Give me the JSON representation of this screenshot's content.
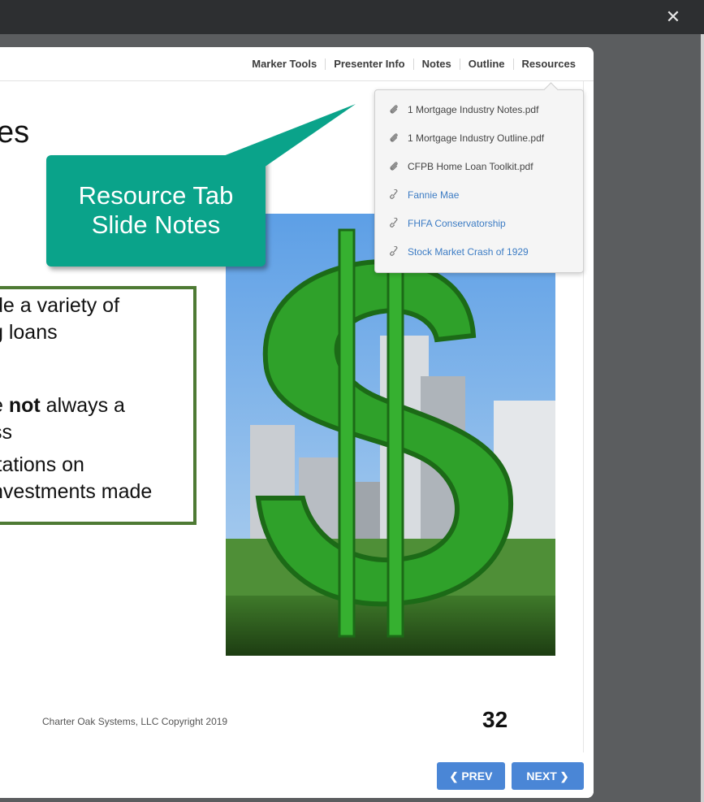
{
  "window": {
    "close_glyph": "✕",
    "close_icon": "close-icon"
  },
  "nav": {
    "tabs": [
      {
        "label": "Marker Tools"
      },
      {
        "label": "Presenter Info"
      },
      {
        "label": "Notes"
      },
      {
        "label": "Outline"
      },
      {
        "label": "Resources"
      }
    ]
  },
  "resources": {
    "items": [
      {
        "label": "1 Mortgage Industry Notes.pdf",
        "kind": "file",
        "icon": "paperclip-icon"
      },
      {
        "label": "1 Mortgage Industry Outline.pdf",
        "kind": "file",
        "icon": "paperclip-icon"
      },
      {
        "label": "CFPB Home Loan Toolkit.pdf",
        "kind": "file",
        "icon": "paperclip-icon"
      },
      {
        "label": "Fannie Mae",
        "kind": "link",
        "icon": "link-icon"
      },
      {
        "label": "FHFA Conservatorship",
        "kind": "link",
        "icon": "link-icon"
      },
      {
        "label": "Stock Market Crash of 1929",
        "kind": "link",
        "icon": "link-icon"
      }
    ]
  },
  "slide": {
    "title_fragment": "es",
    "callout": {
      "line1": "Resource Tab",
      "line2": "Slide Notes"
    },
    "bullets": {
      "l1": "de a variety of",
      "l2": "g loans",
      "l3a": "e ",
      "l3b": "not",
      "l3c": " always a",
      "l4": "ss",
      "l5": "itations on",
      "l6": "nvestments made"
    },
    "footer": "Charter Oak Systems, LLC Copyright 2019",
    "number": "32"
  },
  "controls": {
    "prev": "PREV",
    "next": "NEXT"
  },
  "colors": {
    "accent": "#4a86d6",
    "callout": "#0aa38a",
    "box_border": "#4e7a34",
    "link": "#3c7cc4"
  }
}
